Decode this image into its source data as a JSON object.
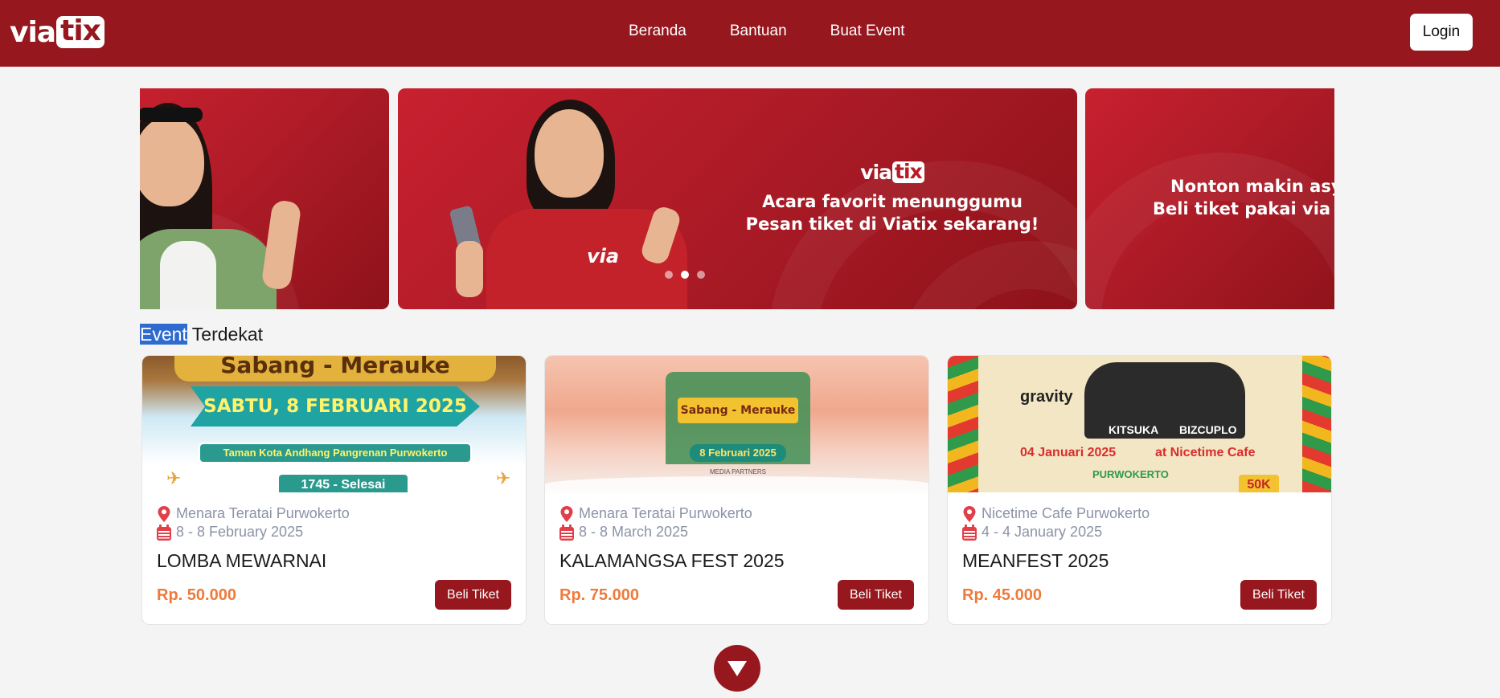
{
  "nav": {
    "logo_via": "via",
    "logo_tix": "tix",
    "links": [
      "Beranda",
      "Bantuan",
      "Buat Event"
    ],
    "login_label": "Login"
  },
  "carousel": {
    "main_logo_via": "via",
    "main_logo_tix": "tix",
    "main_line1": "Acara favorit menunggumu",
    "main_line2": "Pesan tiket di Viatix sekarang!",
    "shirt_text": "via",
    "right_line1": "Nonton makin asy",
    "right_line2": "Beli tiket pakai via",
    "active_slide": 1
  },
  "section": {
    "title_highlight": "Event",
    "title_rest": " Terdekat"
  },
  "events": [
    {
      "location": "Menara Teratai Purwokerto",
      "date": "8 - 8 February 2025",
      "title": "LOMBA MEWARNAI",
      "price": "Rp. 50.000",
      "button": "Beli Tiket",
      "poster_header": "Sabang - Merauke",
      "poster_date": "SABTU, 8 FEBRUARI 2025",
      "poster_venue": "Taman Kota Andhang Pangrenan Purwokerto",
      "poster_time": "1745 - Selesai"
    },
    {
      "location": "Menara Teratai Purwokerto",
      "date": "8 - 8 March 2025",
      "title": "KALAMANGSA FEST 2025",
      "price": "Rp. 75.000",
      "button": "Beli Tiket",
      "poster_title": "Sabang - Merauke",
      "poster_date": "8 Februari 2025",
      "poster_footer": "MEDIA PARTNERS"
    },
    {
      "location": "Nicetime Cafe Purwokerto",
      "date": "4 - 4 January 2025",
      "title": "MEANFEST 2025",
      "price": "Rp. 45.000",
      "button": "Beli Tiket",
      "poster_brand": "gravity",
      "poster_date": "04 Januari 2025",
      "poster_venue": "at Nicetime Cafe",
      "poster_city": "PURWOKERTO",
      "poster_price": "50K",
      "poster_band1": "KITSUKA",
      "poster_band2": "BIZCUPLO"
    }
  ],
  "colors": {
    "brand": "#96171d",
    "price": "#ef7a3a",
    "meta": "#8b93a7",
    "pin": "#e0404a"
  },
  "icons": [
    "location-pin-icon",
    "calendar-icon",
    "chevron-down-icon"
  ]
}
